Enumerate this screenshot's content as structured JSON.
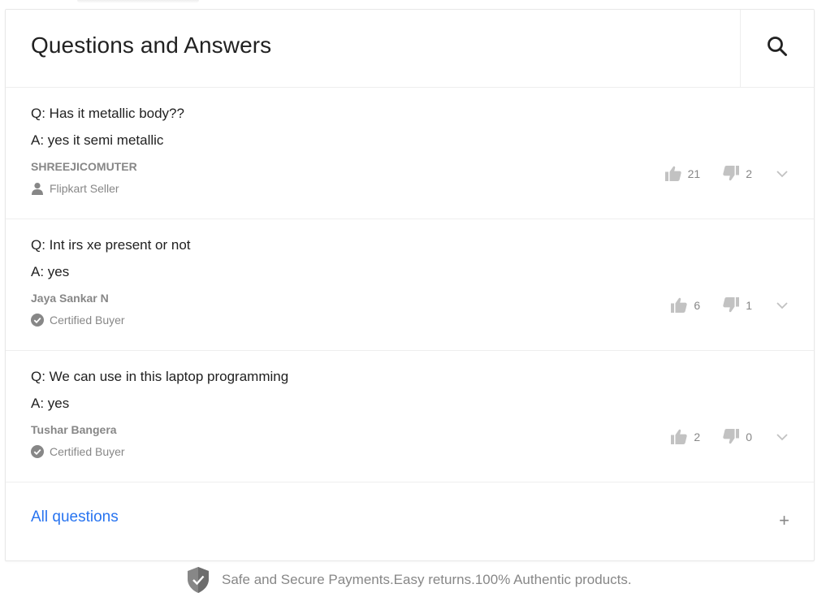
{
  "header": {
    "title": "Questions and Answers",
    "search_icon": "search-icon"
  },
  "qa": [
    {
      "question": "Q: Has it metallic body??",
      "answer_prefix": "A:",
      "answer": " yes it semi metallic",
      "author": "SHREEJICOMUTER",
      "badge": "Flipkart Seller",
      "badge_icon": "person-icon",
      "upvotes": "21",
      "downvotes": "2"
    },
    {
      "question": "Q: Int irs xe present or not",
      "answer_prefix": "A:",
      "answer": " yes",
      "author": "Jaya Sankar N",
      "badge": "Certified Buyer",
      "badge_icon": "check-circle-icon",
      "upvotes": "6",
      "downvotes": "1"
    },
    {
      "question": "Q: We can use in this laptop programming",
      "answer_prefix": "A:",
      "answer": " yes",
      "author": "Tushar Bangera",
      "badge": "Certified Buyer",
      "badge_icon": "check-circle-icon",
      "upvotes": "2",
      "downvotes": "0"
    }
  ],
  "all_questions": {
    "label": "All questions",
    "expand": "+"
  },
  "trust": {
    "text": "Safe and Secure Payments.Easy returns.100% Authentic products.",
    "icon": "shield-check-icon"
  },
  "colors": {
    "link": "#2874f0",
    "muted": "#878787",
    "text": "#212121",
    "border": "#eeeeee"
  }
}
